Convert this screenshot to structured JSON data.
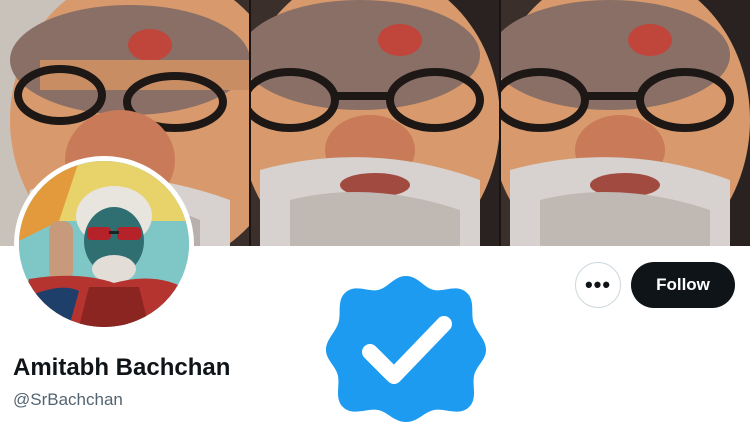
{
  "profile": {
    "display_name": "Amitabh Bachchan",
    "handle": "@SrBachchan",
    "verified": true
  },
  "actions": {
    "more_label": "•••",
    "follow_label": "Follow"
  },
  "colors": {
    "badge_blue": "#1d9bf0",
    "follow_bg": "#0f1419",
    "handle_gray": "#536471"
  },
  "icons": {
    "badge": "verified-badge-icon",
    "more": "more-options-icon"
  }
}
